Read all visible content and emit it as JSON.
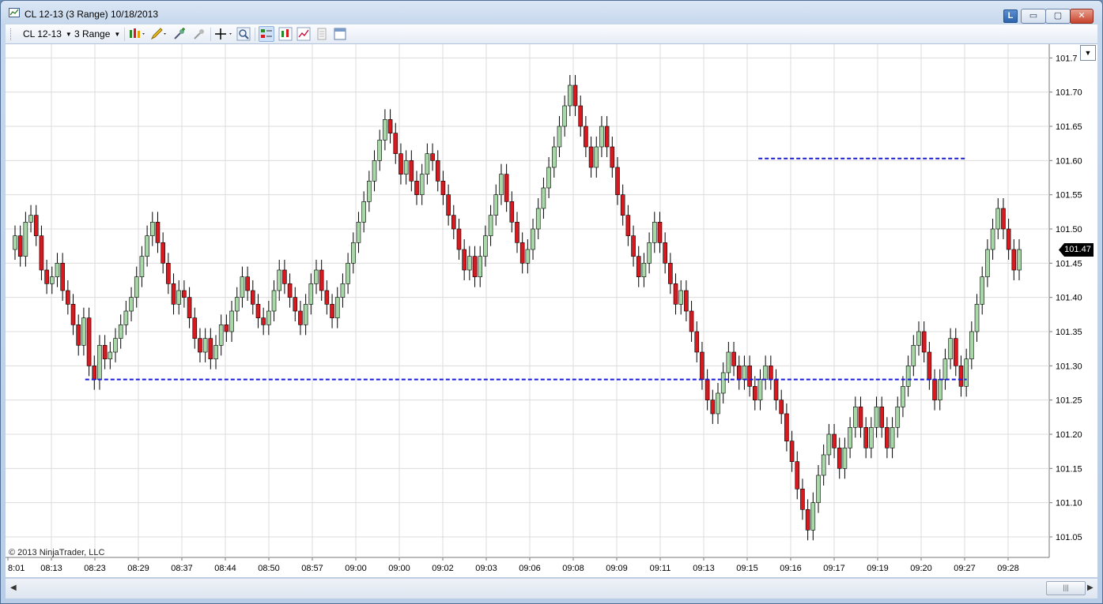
{
  "window": {
    "title": "CL 12-13 (3 Range)  10/18/2013",
    "buttons": {
      "link": "L",
      "minimize": "▭",
      "maximize": "▢",
      "close": "✕"
    }
  },
  "toolbar": {
    "instrument": "CL 12-13",
    "period": "3 Range",
    "icons": [
      "chart-style-icon",
      "drawing-pencil-icon",
      "zoom-in-icon",
      "zoom-out-icon",
      "crosshair-icon",
      "magnifier-icon",
      "data-box-icon",
      "indicators-icon",
      "strategies-icon",
      "properties-icon",
      "panel-icon"
    ]
  },
  "colors": {
    "up": "#a8d8a8",
    "down": "#d71920",
    "wick": "#000000",
    "line": "#1a1ad8",
    "grid": "#dcdcdc"
  },
  "chart": {
    "copyright": "© 2013 NinjaTrader, LLC",
    "last_price": "101.47",
    "dropdown_icon": "chevron-down-icon"
  },
  "chart_data": {
    "type": "candlestick",
    "title": "CL 12-13 (3 Range)",
    "y_ticks": [
      "101.05",
      "101.10",
      "101.15",
      "101.20",
      "101.25",
      "101.30",
      "101.35",
      "101.40",
      "101.45",
      "101.50",
      "101.55",
      "101.60",
      "101.65",
      "101.70",
      "101.7"
    ],
    "ylim": [
      101.02,
      101.77
    ],
    "x_ticks": [
      "8:01",
      "08:13",
      "08:23",
      "08:29",
      "08:37",
      "08:44",
      "08:50",
      "08:57",
      "09:00",
      "09:00",
      "09:02",
      "09:03",
      "09:06",
      "09:08",
      "09:09",
      "09:11",
      "09:13",
      "09:15",
      "09:16",
      "09:17",
      "09:19",
      "09:20",
      "09:27",
      "09:28"
    ],
    "horizontal_lines": [
      {
        "price": 101.603,
        "from_bar": 0.71,
        "to_bar": 0.955
      },
      {
        "price": 101.28,
        "from_bar": 0.065,
        "to_bar": 0.955
      }
    ],
    "last_price": 101.47,
    "closes": [
      101.49,
      101.46,
      101.51,
      101.52,
      101.49,
      101.44,
      101.42,
      101.43,
      101.45,
      101.41,
      101.39,
      101.36,
      101.33,
      101.37,
      101.3,
      101.28,
      101.33,
      101.31,
      101.32,
      101.34,
      101.36,
      101.38,
      101.4,
      101.43,
      101.46,
      101.49,
      101.51,
      101.48,
      101.45,
      101.42,
      101.39,
      101.41,
      101.4,
      101.37,
      101.34,
      101.32,
      101.34,
      101.31,
      101.33,
      101.36,
      101.35,
      101.38,
      101.4,
      101.43,
      101.41,
      101.39,
      101.37,
      101.36,
      101.38,
      101.41,
      101.44,
      101.42,
      101.4,
      101.38,
      101.36,
      101.39,
      101.42,
      101.44,
      101.41,
      101.39,
      101.37,
      101.4,
      101.42,
      101.45,
      101.48,
      101.51,
      101.54,
      101.57,
      101.6,
      101.63,
      101.66,
      101.64,
      101.61,
      101.58,
      101.6,
      101.57,
      101.55,
      101.58,
      101.61,
      101.6,
      101.57,
      101.55,
      101.52,
      101.5,
      101.47,
      101.44,
      101.46,
      101.43,
      101.46,
      101.49,
      101.52,
      101.55,
      101.58,
      101.54,
      101.51,
      101.48,
      101.45,
      101.47,
      101.5,
      101.53,
      101.56,
      101.59,
      101.62,
      101.65,
      101.68,
      101.71,
      101.68,
      101.65,
      101.62,
      101.59,
      101.62,
      101.65,
      101.62,
      101.59,
      101.55,
      101.52,
      101.49,
      101.46,
      101.43,
      101.45,
      101.48,
      101.51,
      101.48,
      101.45,
      101.42,
      101.39,
      101.41,
      101.38,
      101.35,
      101.32,
      101.28,
      101.25,
      101.23,
      101.26,
      101.29,
      101.32,
      101.3,
      101.28,
      101.3,
      101.27,
      101.25,
      101.28,
      101.3,
      101.28,
      101.25,
      101.23,
      101.19,
      101.16,
      101.12,
      101.09,
      101.06,
      101.1,
      101.14,
      101.17,
      101.2,
      101.18,
      101.15,
      101.18,
      101.21,
      101.24,
      101.21,
      101.18,
      101.21,
      101.24,
      101.21,
      101.18,
      101.21,
      101.24,
      101.27,
      101.3,
      101.33,
      101.35,
      101.32,
      101.28,
      101.25,
      101.28,
      101.31,
      101.34,
      101.3,
      101.27,
      101.31,
      101.35,
      101.39,
      101.43,
      101.47,
      101.5,
      101.53,
      101.5,
      101.47,
      101.44,
      101.47
    ]
  }
}
